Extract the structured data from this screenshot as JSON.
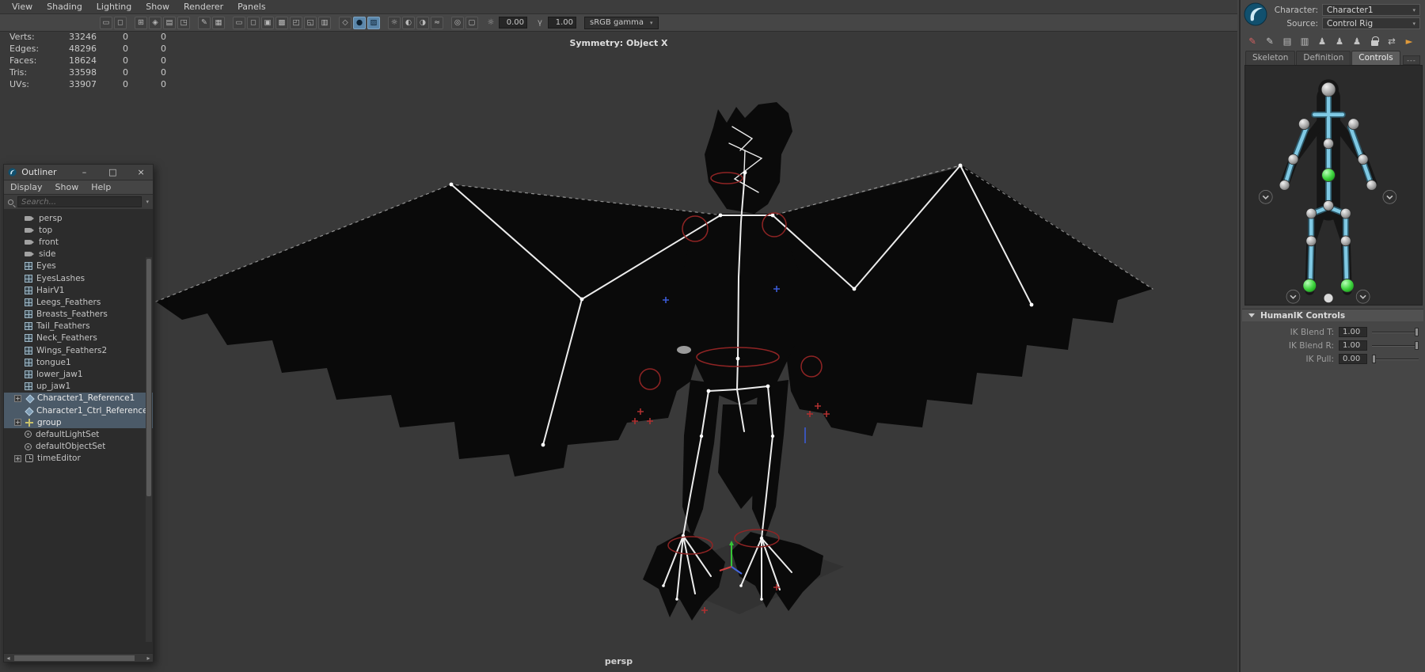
{
  "panel_menubar": {
    "items": [
      "View",
      "Shading",
      "Lighting",
      "Show",
      "Renderer",
      "Panels"
    ]
  },
  "viewport_toolbar": {
    "exposure_icon": "☼",
    "exposure_value": "0.00",
    "gamma_icon": "γ",
    "gamma_value": "1.00",
    "color_mode": "sRGB gamma",
    "icons": [
      {
        "name": "select-camera-icon",
        "glyph": "▭"
      },
      {
        "name": "lock-camera-icon",
        "glyph": "◻"
      },
      {
        "name": "camera-attributes-icon",
        "glyph": "⊞"
      },
      {
        "name": "bookmarks-icon",
        "glyph": "◈"
      },
      {
        "name": "image-plane-icon",
        "glyph": "▤"
      },
      {
        "name": "pan-zoom-icon",
        "glyph": "◳"
      },
      {
        "name": "grease-pencil-icon",
        "glyph": "✎"
      },
      {
        "name": "grid-icon",
        "glyph": "▦"
      },
      {
        "name": "film-gate-icon",
        "glyph": "▭"
      },
      {
        "name": "resolution-gate-icon",
        "glyph": "◻"
      },
      {
        "name": "gate-mask-icon",
        "glyph": "▣"
      },
      {
        "name": "field-chart-icon",
        "glyph": "▩"
      },
      {
        "name": "safe-action-icon",
        "glyph": "◰"
      },
      {
        "name": "safe-title-icon",
        "glyph": "◱"
      },
      {
        "name": "hud-toggle-icon",
        "glyph": "▥"
      },
      {
        "name": "wireframe-icon",
        "glyph": "◇"
      },
      {
        "name": "shaded-icon",
        "glyph": "●"
      },
      {
        "name": "textured-icon",
        "glyph": "▨"
      },
      {
        "name": "lights-icon",
        "glyph": "☼"
      },
      {
        "name": "shadows-icon",
        "glyph": "◐"
      },
      {
        "name": "ao-icon",
        "glyph": "◑"
      },
      {
        "name": "motion-blur-icon",
        "glyph": "≈"
      },
      {
        "name": "xray-icon",
        "glyph": "◎"
      },
      {
        "name": "isolate-select-icon",
        "glyph": "▢"
      }
    ]
  },
  "hud": {
    "symmetry": "Symmetry: Object X",
    "camera": "persp",
    "stats": [
      {
        "label": "Verts:",
        "value": "33246",
        "col1": "0",
        "col2": "0"
      },
      {
        "label": "Edges:",
        "value": "48296",
        "col1": "0",
        "col2": "0"
      },
      {
        "label": "Faces:",
        "value": "18624",
        "col1": "0",
        "col2": "0"
      },
      {
        "label": "Tris:",
        "value": "33598",
        "col1": "0",
        "col2": "0"
      },
      {
        "label": "UVs:",
        "value": "33907",
        "col1": "0",
        "col2": "0"
      }
    ]
  },
  "outliner": {
    "title": "Outliner",
    "window_buttons": {
      "minimize": "–",
      "maximize": "□",
      "close": "×"
    },
    "menus": [
      "Display",
      "Show",
      "Help"
    ],
    "search_placeholder": "Search...",
    "items": [
      {
        "label": "persp",
        "icon": "camera-icon"
      },
      {
        "label": "top",
        "icon": "camera-icon"
      },
      {
        "label": "front",
        "icon": "camera-icon"
      },
      {
        "label": "side",
        "icon": "camera-icon"
      },
      {
        "label": "Eyes",
        "icon": "mesh-icon"
      },
      {
        "label": "EyesLashes",
        "icon": "mesh-icon"
      },
      {
        "label": "HairV1",
        "icon": "mesh-icon"
      },
      {
        "label": "Leegs_Feathers",
        "icon": "mesh-icon"
      },
      {
        "label": "Breasts_Feathers",
        "icon": "mesh-icon"
      },
      {
        "label": "Tail_Feathers",
        "icon": "mesh-icon"
      },
      {
        "label": "Neck_Feathers",
        "icon": "mesh-icon"
      },
      {
        "label": "Wings_Feathers2",
        "icon": "mesh-icon"
      },
      {
        "label": "tongue1",
        "icon": "mesh-icon"
      },
      {
        "label": "lower_jaw1",
        "icon": "mesh-icon"
      },
      {
        "label": "up_jaw1",
        "icon": "mesh-icon"
      },
      {
        "label": "Character1_Reference1",
        "icon": "reference-icon",
        "selected": true,
        "expandable": true
      },
      {
        "label": "Character1_Ctrl_Reference",
        "icon": "reference-icon",
        "selected": true
      },
      {
        "label": "group",
        "icon": "group-icon",
        "selected": true,
        "expandable": true
      },
      {
        "label": "defaultLightSet",
        "icon": "set-icon"
      },
      {
        "label": "defaultObjectSet",
        "icon": "set-icon"
      },
      {
        "label": "timeEditor",
        "icon": "time-editor-icon",
        "expandable": true
      }
    ]
  },
  "character_panel": {
    "character_label": "Character:",
    "character_value": "Character1",
    "source_label": "Source:",
    "source_value": "Control Rig",
    "tabs": [
      "Skeleton",
      "Definition",
      "Controls"
    ],
    "active_tab": "Controls",
    "tab_menu_glyph": "---",
    "tools": [
      {
        "name": "edit-character-pencil-icon",
        "glyph": "✎"
      },
      {
        "name": "annotate-pencil-icon",
        "glyph": "✎"
      },
      {
        "name": "character-list-icon",
        "glyph": "▤"
      },
      {
        "name": "attribute-table-icon",
        "glyph": "▥"
      },
      {
        "name": "character-figure-icon",
        "glyph": "♟"
      },
      {
        "name": "skeleton-figure-icon",
        "glyph": "♟"
      },
      {
        "name": "stance-pose-icon",
        "glyph": "♟"
      },
      {
        "name": "lock-stance-icon",
        "glyph": ""
      },
      {
        "name": "mirror-icon",
        "glyph": "⇄"
      },
      {
        "name": "bake-arrow-icon",
        "glyph": "►"
      }
    ],
    "hik_section_title": "HumanIK Controls",
    "attributes": [
      {
        "label": "IK Blend T:",
        "value": "1.00"
      },
      {
        "label": "IK Blend R:",
        "value": "1.00"
      },
      {
        "label": "IK Pull:",
        "value": "0.00"
      }
    ]
  },
  "ui": {
    "chevron_down": "▾",
    "expand_glyph": "+",
    "scroll_left": "◂",
    "scroll_right": "▸"
  },
  "colors": {
    "selection_highlight": "#4b5a68",
    "control_cyan": "#7fc9e4",
    "control_green": "#3ecf3e",
    "accent_orange": "#e09a3a",
    "accent_red": "#d06060",
    "viewport_bg": "#393939"
  }
}
